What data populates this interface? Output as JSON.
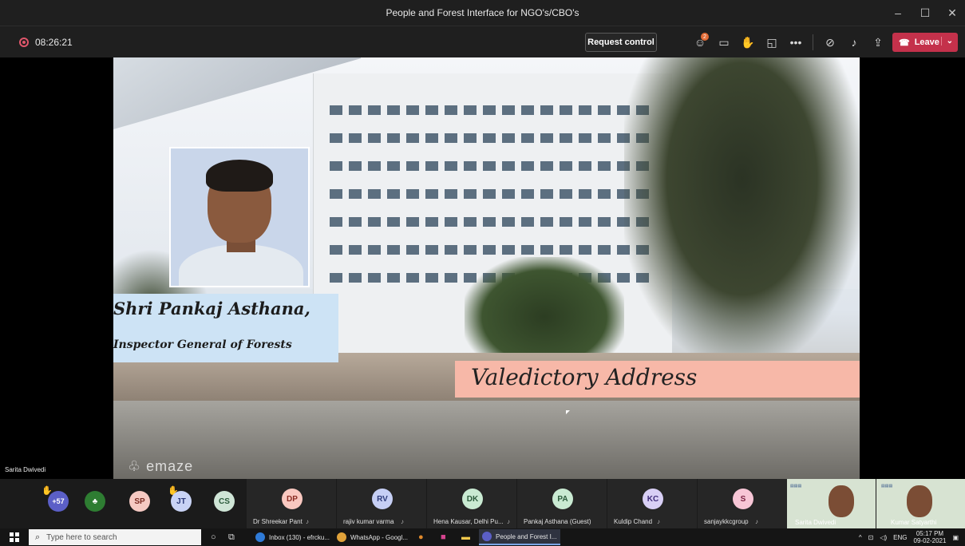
{
  "window": {
    "title": "People and Forest Interface for NGO's/CBO's",
    "controls": [
      "–",
      "☐",
      "✕"
    ]
  },
  "toolbar": {
    "timer": "08:26:21",
    "request_control": "Request control",
    "participants_badge": "2",
    "leave_label": "Leave"
  },
  "slide": {
    "name": "Shri Pankaj Asthana,",
    "designation": "Inspector General of Forests",
    "title": "Valedictory Address",
    "watermark": "emaze"
  },
  "presenter_label": "Sarita Dwivedi",
  "strip": {
    "overflow_count": "+57",
    "avatars": [
      {
        "initials": "SP",
        "color": "#f5c9c2",
        "fg": "#7a2b22"
      },
      {
        "initials": "JT",
        "color": "#c9d3f5",
        "fg": "#2c3a7a"
      },
      {
        "initials": "CS",
        "color": "#cfe5d6",
        "fg": "#2a5a3a"
      }
    ],
    "tiles": [
      {
        "initials": "DP",
        "name": "Dr Shreekar Pant",
        "color": "#f9c8c0",
        "fg": "#8a2b22"
      },
      {
        "initials": "RV",
        "name": "rajiv kumar varma",
        "color": "#c6cff5",
        "fg": "#2c3a7a"
      },
      {
        "initials": "DK",
        "name": "Hena Kausar, Delhi Pu...",
        "color": "#c9ead2",
        "fg": "#2a5a3a"
      },
      {
        "initials": "PA",
        "name": "Pankaj Asthana (Guest)",
        "color": "#c9ead2",
        "fg": "#2a5a3a"
      },
      {
        "initials": "KC",
        "name": "Kuldip Chand",
        "color": "#d8cff5",
        "fg": "#3f2c7a"
      },
      {
        "initials": "S",
        "name": "sanjaykkcgroup",
        "color": "#f7c6d6",
        "fg": "#7a2242"
      }
    ],
    "video": [
      {
        "name": "Sarita Dwivedi"
      },
      {
        "name": "Kumar Satyarthi"
      }
    ]
  },
  "taskbar": {
    "search_placeholder": "Type here to search",
    "apps": [
      {
        "label": "Inbox (130) - efrcku...",
        "color": "#2f7bd8"
      },
      {
        "label": "WhatsApp - Googl...",
        "color": "#e0a23a"
      },
      {
        "label": "People and Forest I...",
        "color": "#5b5fc7"
      }
    ],
    "lang": "ENG",
    "time": "05:17 PM",
    "date": "09-02-2021"
  }
}
